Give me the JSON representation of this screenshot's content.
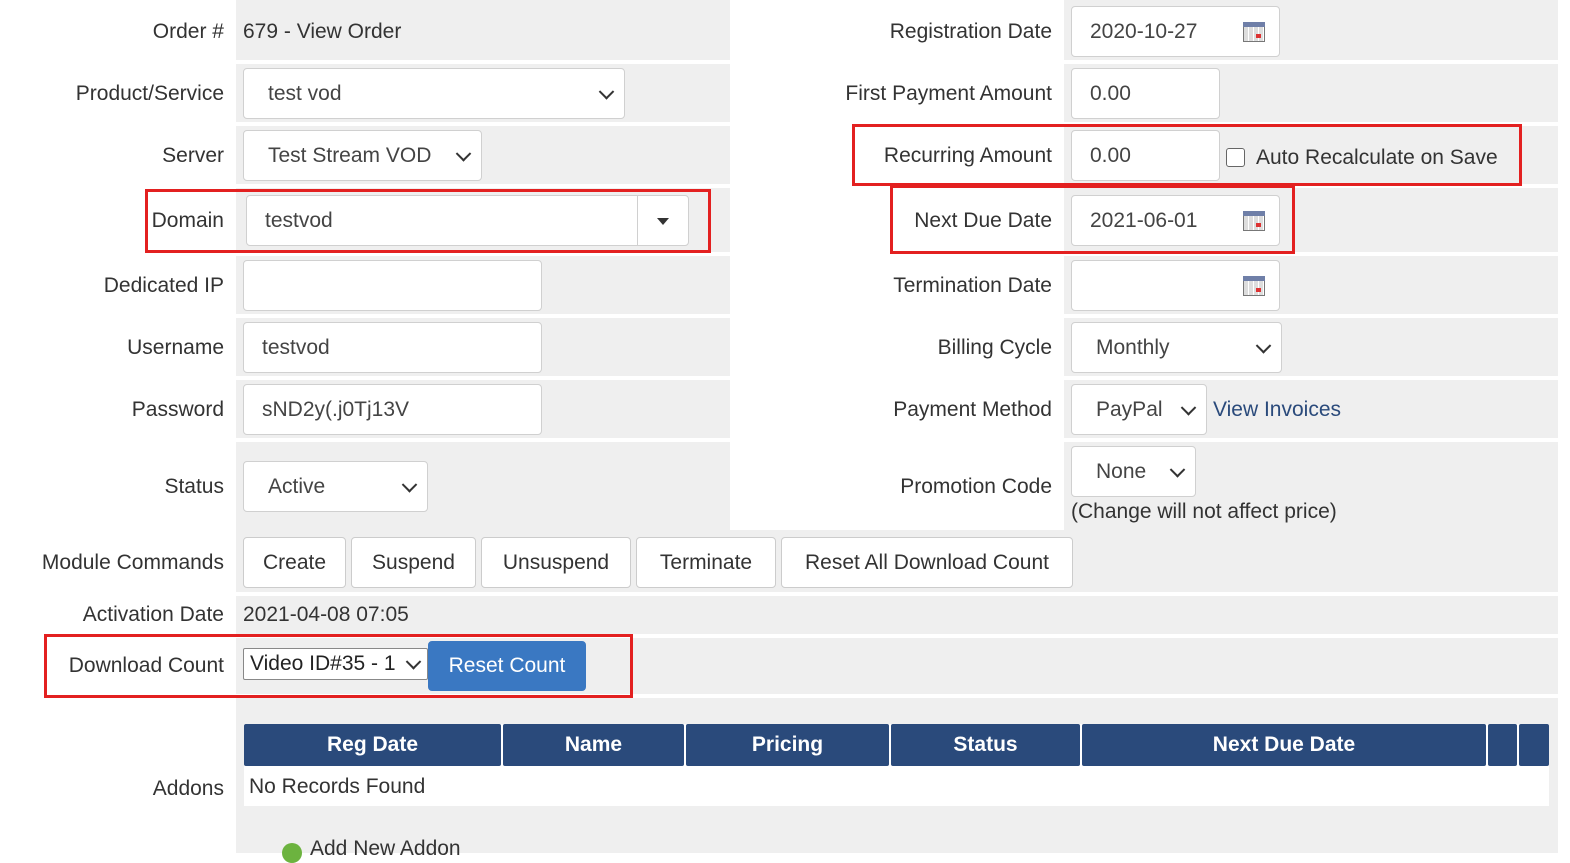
{
  "order": {
    "label": "Order #",
    "value": "679 - View Order"
  },
  "left": {
    "product": {
      "label": "Product/Service",
      "value": "test vod"
    },
    "server": {
      "label": "Server",
      "value": "Test Stream VOD"
    },
    "domain": {
      "label": "Domain",
      "value": "testvod"
    },
    "dedicated_ip": {
      "label": "Dedicated IP",
      "value": ""
    },
    "username": {
      "label": "Username",
      "value": "testvod"
    },
    "password": {
      "label": "Password",
      "value": "sND2y(.j0Tj13V"
    },
    "status": {
      "label": "Status",
      "value": "Active"
    }
  },
  "right": {
    "registration_date": {
      "label": "Registration Date",
      "value": "2020-10-27"
    },
    "first_payment": {
      "label": "First Payment Amount",
      "value": "0.00"
    },
    "recurring": {
      "label": "Recurring Amount",
      "value": "0.00",
      "checkbox_label": "Auto Recalculate on Save"
    },
    "next_due": {
      "label": "Next Due Date",
      "value": "2021-06-01"
    },
    "termination": {
      "label": "Termination Date",
      "value": ""
    },
    "billing_cycle": {
      "label": "Billing Cycle",
      "value": "Monthly"
    },
    "payment_method": {
      "label": "Payment Method",
      "value": "PayPal",
      "link": "View Invoices"
    },
    "promotion": {
      "label": "Promotion Code",
      "value": "None",
      "note": "(Change will not affect price)"
    }
  },
  "module_commands": {
    "label": "Module Commands",
    "buttons": [
      "Create",
      "Suspend",
      "Unsuspend",
      "Terminate",
      "Reset All Download Count"
    ]
  },
  "activation": {
    "label": "Activation Date",
    "value": "2021-04-08 07:05"
  },
  "download": {
    "label": "Download Count",
    "value": "Video ID#35 - 1",
    "button": "Reset Count"
  },
  "addons": {
    "label": "Addons",
    "columns": [
      "Reg Date",
      "Name",
      "Pricing",
      "Status",
      "Next Due Date"
    ],
    "empty": "No Records Found",
    "add_link": "Add New Addon"
  },
  "colors": {
    "header_bg": "#2a4a7b",
    "primary_button": "#3a78c2",
    "highlight": "#e32020",
    "field_bg": "#efefef"
  }
}
